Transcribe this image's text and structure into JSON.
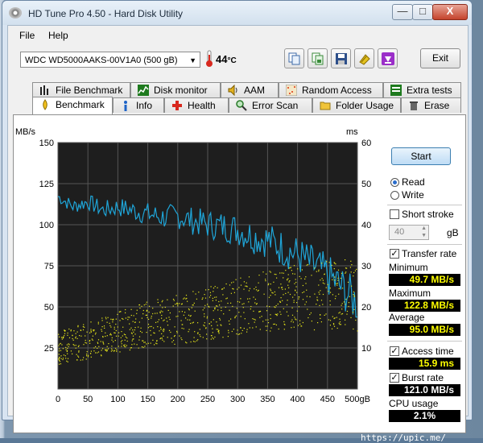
{
  "window": {
    "title": "HD Tune Pro 4.50 - Hard Disk Utility",
    "controls": {
      "minimize": "—",
      "maximize": "□",
      "close": "X"
    }
  },
  "menu": [
    "File",
    "Help"
  ],
  "toolbar": {
    "drive": "WDC WD5000AAKS-00V1A0    (500 gB)",
    "temperature": "44",
    "temp_unit": "°C",
    "exit_label": "Exit",
    "icons": [
      "copy-text-icon",
      "copy-screenshot-icon",
      "save-icon",
      "options-icon",
      "download-icon"
    ]
  },
  "tabs_row1": [
    {
      "label": "File Benchmark",
      "icon": "file-benchmark-icon"
    },
    {
      "label": "Disk monitor",
      "icon": "disk-monitor-icon"
    },
    {
      "label": "AAM",
      "icon": "speaker-icon"
    },
    {
      "label": "Random Access",
      "icon": "random-access-icon"
    },
    {
      "label": "Extra tests",
      "icon": "extra-tests-icon"
    }
  ],
  "tabs_row2": [
    {
      "label": "Benchmark",
      "icon": "benchmark-icon",
      "active": true
    },
    {
      "label": "Info",
      "icon": "info-icon"
    },
    {
      "label": "Health",
      "icon": "health-icon"
    },
    {
      "label": "Error Scan",
      "icon": "error-scan-icon"
    },
    {
      "label": "Folder Usage",
      "icon": "folder-icon"
    },
    {
      "label": "Erase",
      "icon": "trash-icon"
    }
  ],
  "chart_data": {
    "type": "line",
    "left_unit": "MB/s",
    "right_unit": "ms",
    "x_ticks": [
      "0",
      "50",
      "100",
      "150",
      "200",
      "250",
      "300",
      "350",
      "400",
      "450",
      "500gB"
    ],
    "y_left_ticks": [
      "150",
      "125",
      "100",
      "75",
      "50",
      "25"
    ],
    "y_right_ticks": [
      "60",
      "50",
      "40",
      "30",
      "20",
      "10"
    ],
    "xlim": [
      0,
      500
    ],
    "ylim_left": [
      0,
      150
    ],
    "ylim_right": [
      0,
      60
    ],
    "grid": true,
    "series": [
      {
        "color": "#1fa5d8",
        "x": [
          0,
          25,
          50,
          75,
          100,
          125,
          150,
          175,
          200,
          225,
          250,
          275,
          300,
          325,
          350,
          375,
          400,
          425,
          450,
          475,
          500
        ],
        "values": [
          118,
          112,
          115,
          110,
          112,
          110,
          108,
          106,
          107,
          104,
          102,
          101,
          99,
          95,
          93,
          88,
          84,
          78,
          72,
          64,
          55
        ]
      },
      {
        "color": "#e8e81a",
        "kind": "scatter",
        "x": [
          0,
          50,
          100,
          150,
          200,
          250,
          300,
          350,
          400,
          450,
          500
        ],
        "values": [
          10,
          12,
          14,
          16,
          17,
          18.5,
          20,
          21.5,
          22.5,
          23,
          23
        ]
      }
    ]
  },
  "controls": {
    "start_label": "Start",
    "read_label": "Read",
    "write_label": "Write",
    "short_stroke_label": "Short stroke",
    "stroke_value": "40",
    "stroke_unit": "gB",
    "transfer_rate_label": "Transfer rate",
    "minimum_label": "Minimum",
    "minimum_value": "49.7 MB/s",
    "maximum_label": "Maximum",
    "maximum_value": "122.8 MB/s",
    "average_label": "Average",
    "average_value": "95.0 MB/s",
    "access_time_label": "Access time",
    "access_time_value": "15.9 ms",
    "burst_rate_label": "Burst rate",
    "burst_rate_value": "121.0 MB/s",
    "cpu_label": "CPU usage",
    "cpu_value": "2.1%"
  },
  "footer": "[609x533] https://upic.me/"
}
